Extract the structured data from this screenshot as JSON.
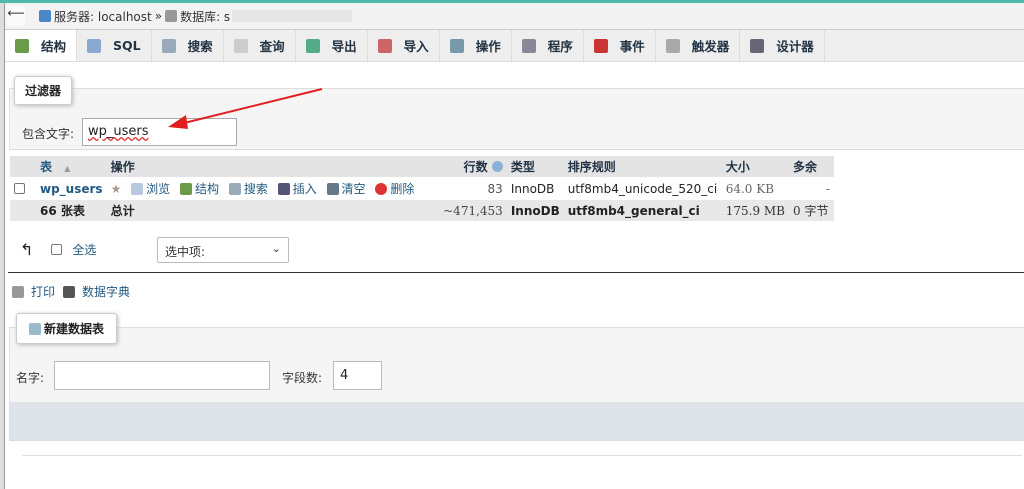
{
  "breadcrumb": {
    "server_label": "服务器: localhost",
    "separator": "»",
    "db_label": "数据库: s"
  },
  "tabs": [
    {
      "label": "结构",
      "icon": "structure-icon",
      "active": true
    },
    {
      "label": "SQL",
      "icon": "sql-icon"
    },
    {
      "label": "搜索",
      "icon": "search-icon"
    },
    {
      "label": "查询",
      "icon": "query-icon"
    },
    {
      "label": "导出",
      "icon": "export-icon"
    },
    {
      "label": "导入",
      "icon": "import-icon"
    },
    {
      "label": "操作",
      "icon": "wrench-icon"
    },
    {
      "label": "程序",
      "icon": "routines-icon"
    },
    {
      "label": "事件",
      "icon": "clock-icon"
    },
    {
      "label": "触发器",
      "icon": "triggers-icon"
    },
    {
      "label": "设计器",
      "icon": "designer-icon"
    }
  ],
  "filter": {
    "legend": "过滤器",
    "label": "包含文字:",
    "value": "wp_users"
  },
  "table": {
    "headers": {
      "table": "表",
      "sort": "▲",
      "actions": "操作",
      "rows": "行数",
      "type": "类型",
      "collation": "排序规则",
      "size": "大小",
      "overhead": "多余"
    },
    "row": {
      "name": "wp_users",
      "actions": [
        "浏览",
        "结构",
        "搜索",
        "插入",
        "清空",
        "删除"
      ],
      "rows": "83",
      "type": "InnoDB",
      "collation": "utf8mb4_unicode_520_ci",
      "size": "64.0 KB",
      "overhead": "-"
    },
    "total": {
      "count": "66 张表",
      "label": "总计",
      "rows": "~471,453",
      "type": "InnoDB",
      "collation": "utf8mb4_general_ci",
      "size": "175.9 MB",
      "overhead": "0 字节"
    }
  },
  "bulk": {
    "select_all": "全选",
    "with_selected": "选中项:"
  },
  "links": {
    "print": "打印",
    "dictionary": "数据字典"
  },
  "create": {
    "legend": "新建数据表",
    "name_label": "名字:",
    "name_value": "",
    "cols_label": "字段数:",
    "cols_value": "4"
  },
  "colors": {
    "accent": "#4fb8a8",
    "link": "#235a81"
  }
}
